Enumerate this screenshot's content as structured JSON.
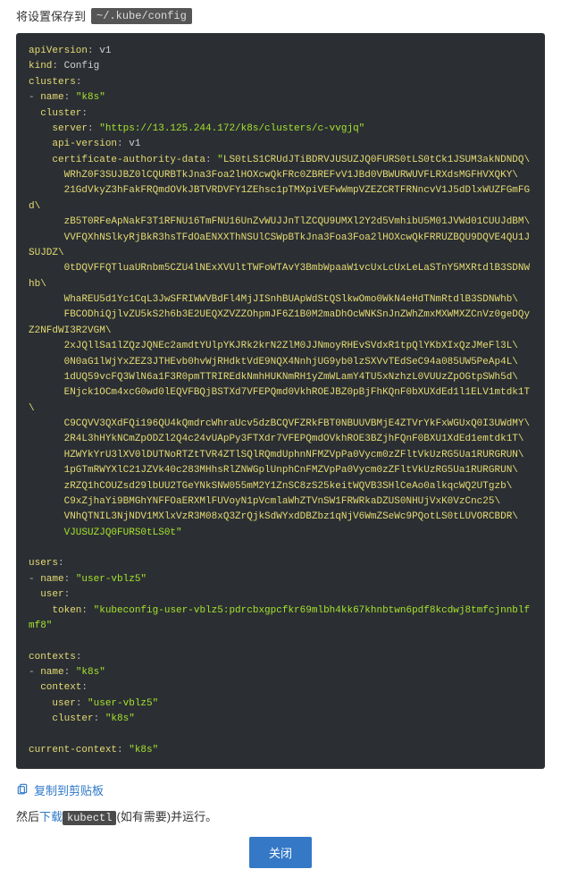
{
  "top": {
    "prefix": "将设置保存到",
    "path": "~/.kube/config"
  },
  "kubeconfig": {
    "apiVersion_key": "apiVersion",
    "apiVersion_val": "v1",
    "kind_key": "kind",
    "kind_val": "Config",
    "clusters_key": "clusters",
    "name_key": "name",
    "cluster_name": "\"k8s\"",
    "cluster_key": "cluster",
    "server_key": "server",
    "server_val": "\"https://13.125.244.172/k8s/clusters/c-vvgjq\"",
    "apiver_key": "api-version",
    "apiver_val": "v1",
    "cad_key": "certificate-authority-data",
    "cad_prefix": "\"",
    "cad_lines": [
      "LS0tLS1CRUdJTiBDRVJUSUZJQ0FURS0tLS0tCk1JSUM3akNDNDQ\\",
      "WRhZ0F3SUJBZ0lCQURBTkJna3Foa2lHOXcwQkFRc0ZBREFvV1JBd0VBWURWUVFLRXdsMGFHVXQKY\\",
      "21GdVkyZ3hFakFRQmdOVkJBTVRDVFY1ZEhsc1pTMXpiVEFwWmpVZEZCRTFRNncvV1J5dDlxWUZFGmFGd\\",
      "zB5T0RFeApNakF3T1RFNU16TmFNU16UnZvWUJJnTlZCQU9UMXl2Y2d5VmhibU5M01JVWd01CUUJdBM\\",
      "VVFQXhNSlkyRjBkR3hsTFdOaENXXThNSUlCSWpBTkJna3Foa3Foa2lHOXcwQkFRRUZBQU9DQVE4QU1JSUJDZ\\",
      "0tDQVFFQTluaURnbm5CZU4lNExXVUltTWFoWTAvY3BmbWpaaW1vcUxLcUxLeLaSTnY5MXRtdlB3SDNWhb\\",
      "WhaREU5d1Yc1CqL3JwSFRIWWVBdFl4MjJISnhBUApWdStQSlkwOmo0WkN4eHdTNmRtdlB3SDNWhb\\",
      "FBCODhiQjlvZU5kS2h6b3E2UEQXZVZZOhpmJF6Z1B0M2maDhOcWNKSnJnZWhZmxMXWMXZCnVz0geDQyZ2NFdWI3R2VGM\\",
      "2xJQllSa1lZQzJQNEc2amdtYUlpYKJRk2krN2ZlM0JJNmoyRHEvSVdxR1tpQlYKbXIxQzJMeFl3L\\",
      "0N0aG1lWjYxZEZ3JTHEvb0hvWjRHdktVdE9NQX4NnhjUG9yb0lzSXVvTEdSeC94a085UW5PeAp4L\\",
      "1dUQ59vcFQ3WlN6a1F3R0pmTTRIREdkNmhHUKNmRH1yZmWLamY4TU5xNzhzL0VUUzZpOGtpSWh5d\\",
      "ENjck1OCm4xcG0wd0lEQVFBQjBSTXd7VFEPQmd0VkhROEJBZ0pBjFhKQnF0bXUXdEd1l1ELV1mtdk1T\\",
      "C9CQVV3QXdFQi196QU4kQmdrcWhraUcv5dzBCQVFZRkFBT0NBUUVBMjE4ZTVrYkFxWGUxQ0I3UWdMY\\",
      "2R4L3hHYkNCmZpODZl2Q4c24vUApPy3FTXdr7VFEPQmdOVkhROE3BZjhFQnF0BXU1XdEd1emtdk1T\\",
      "HZWYkYrU3lXV0lDUTNoRTZtTVR4ZTlSQlRQmdUphnNFMZVpPa0Vycm0zZFltVkUzRG5Ua1RURGRUN\\",
      "1pGTmRWYXlC21JZVk40c283MHhsRlZNWGplUnphCnFMZVpPa0Vycm0zZFltVkUzRG5Ua1RURGRUN\\",
      "zRZQ1hCOUZsd29lbUU2TGeYNkSNW055mM2Y1ZnSC8zS25keitWQVB3SHlCeAo0alkqcWQ2UTgzb\\",
      "C9xZjhaYi9BMGhYNFFOaERXMlFUVoyN1pVcmlaWhZTVnSW1FRWRkaDZUS0NHUjVxK0VzCnc25\\",
      "VNhQTNIL3NjNDV1MXlxVzR3M08xQ3ZrQjkSdWYxdDBZbz1qNjV6WmZSeWc9PQotLS0tLUVORCBDR\\"
    ],
    "cad_last": "VJUSUZJQ0FURS0tLS0t\"",
    "users_key": "users",
    "user_name": "\"user-vblz5\"",
    "user_key": "user",
    "token_key": "token",
    "token_val": "\"kubeconfig-user-vblz5:pdrcbxgpcfkr69mlbh4kk67khnbtwn6pdf8kcdwj8tmfcjnnblfmf8\"",
    "contexts_key": "contexts",
    "ctx_name": "\"k8s\"",
    "context_key": "context",
    "ctx_user_key": "user",
    "ctx_user_val": "\"user-vblz5\"",
    "ctx_cluster_key": "cluster",
    "ctx_cluster_val": "\"k8s\"",
    "current_key": "current-context",
    "current_val": "\"k8s\""
  },
  "copy_label": "复制到剪贴板",
  "instruct": {
    "before": "然后",
    "link": "下载",
    "chip": "kubectl",
    "after": "(如有需要)并运行。"
  },
  "close_label": "关闭"
}
